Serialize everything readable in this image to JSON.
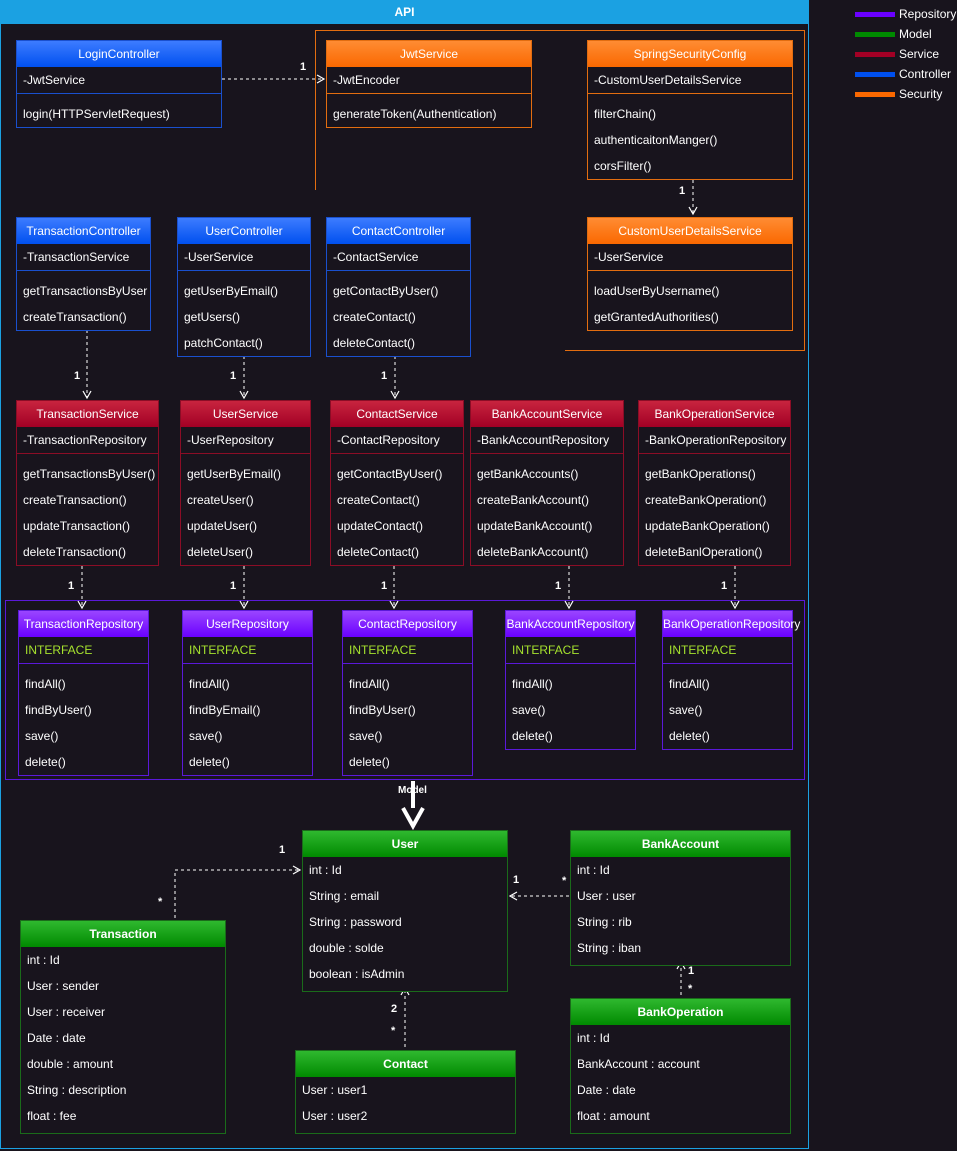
{
  "title": "API",
  "model_label": "Model",
  "legend": [
    {
      "label": "Repository",
      "color": "#6a00ff"
    },
    {
      "label": "Model",
      "color": "#008a00"
    },
    {
      "label": "Service",
      "color": "#a20025"
    },
    {
      "label": "Controller",
      "color": "#0050ef"
    },
    {
      "label": "Security",
      "color": "#fa6800"
    }
  ],
  "classes": {
    "login_controller": {
      "name": "LoginController",
      "fields": [
        "-JwtService"
      ],
      "methods": [
        "login(HTTPServletRequest)"
      ]
    },
    "jwt_service": {
      "name": "JwtService",
      "fields": [
        "-JwtEncoder"
      ],
      "methods": [
        "generateToken(Authentication)"
      ]
    },
    "spring_security_config": {
      "name": "SpringSecurityConfig",
      "fields": [
        "-CustomUserDetailsService"
      ],
      "methods": [
        "filterChain()",
        "authenticaitonManger()",
        "corsFilter()"
      ]
    },
    "custom_user_details_service": {
      "name": "CustomUserDetailsService",
      "fields": [
        "-UserService"
      ],
      "methods": [
        "loadUserByUsername()",
        "getGrantedAuthorities()"
      ]
    },
    "transaction_controller": {
      "name": "TransactionController",
      "fields": [
        "-TransactionService"
      ],
      "methods": [
        "getTransactionsByUser",
        "createTransaction()"
      ]
    },
    "user_controller": {
      "name": "UserController",
      "fields": [
        "-UserService"
      ],
      "methods": [
        "getUserByEmail()",
        "getUsers()",
        "patchContact()"
      ]
    },
    "contact_controller": {
      "name": "ContactController",
      "fields": [
        "-ContactService"
      ],
      "methods": [
        "getContactByUser()",
        "createContact()",
        "deleteContact()"
      ]
    },
    "transaction_service": {
      "name": "TransactionService",
      "fields": [
        "-TransactionRepository"
      ],
      "methods": [
        "getTransactionsByUser()",
        "createTransaction()",
        "updateTransaction()",
        "deleteTransaction()"
      ]
    },
    "user_service": {
      "name": "UserService",
      "fields": [
        "-UserRepository"
      ],
      "methods": [
        "getUserByEmail()",
        "createUser()",
        "updateUser()",
        "deleteUser()"
      ]
    },
    "contact_service": {
      "name": "ContactService",
      "fields": [
        "-ContactRepository"
      ],
      "methods": [
        "getContactByUser()",
        "createContact()",
        "updateContact()",
        "deleteContact()"
      ]
    },
    "bank_account_service": {
      "name": "BankAccountService",
      "fields": [
        "-BankAccountRepository"
      ],
      "methods": [
        "getBankAccounts()",
        "createBankAccount()",
        "updateBankAccount()",
        "deleteBankAccount()"
      ]
    },
    "bank_operation_service": {
      "name": "BankOperationService",
      "fields": [
        "-BankOperationRepository"
      ],
      "methods": [
        "getBankOperations()",
        "createBankOperation()",
        "updateBankOperation()",
        "deleteBanlOperation()"
      ]
    },
    "transaction_repository": {
      "name": "TransactionRepository",
      "fields": [
        "INTERFACE"
      ],
      "methods": [
        "findAll()",
        "findByUser()",
        "save()",
        "delete()"
      ]
    },
    "user_repository": {
      "name": "UserRepository",
      "fields": [
        "INTERFACE"
      ],
      "methods": [
        "findAll()",
        "findByEmail()",
        "save()",
        "delete()"
      ]
    },
    "contact_repository": {
      "name": "ContactRepository",
      "fields": [
        "INTERFACE"
      ],
      "methods": [
        "findAll()",
        "findByUser()",
        "save()",
        "delete()"
      ]
    },
    "bank_account_repository": {
      "name": "BankAccountRepository",
      "fields": [
        "INTERFACE"
      ],
      "methods": [
        "findAll()",
        "save()",
        "delete()"
      ]
    },
    "bank_operation_repository": {
      "name": "BankOperationRepository",
      "fields": [
        "INTERFACE"
      ],
      "methods": [
        "findAll()",
        "save()",
        "delete()"
      ]
    },
    "user": {
      "name": "User",
      "fields": [
        "int : Id",
        "String : email",
        "String : password",
        "double : solde",
        "boolean : isAdmin"
      ],
      "methods": []
    },
    "bank_account": {
      "name": "BankAccount",
      "fields": [
        "int : Id",
        "User : user",
        "String : rib",
        "String : iban"
      ],
      "methods": []
    },
    "transaction": {
      "name": "Transaction",
      "fields": [
        "int : Id",
        "User : sender",
        "User : receiver",
        "Date : date",
        "double : amount",
        "String : description",
        "float : fee"
      ],
      "methods": []
    },
    "contact": {
      "name": "Contact",
      "fields": [
        "User : user1",
        "User : user2"
      ],
      "methods": []
    },
    "bank_operation": {
      "name": "BankOperation",
      "fields": [
        "int : Id",
        "BankAccount : account",
        "Date : date",
        "float : amount"
      ],
      "methods": []
    }
  },
  "multiplicities": {
    "login_jwt": "1",
    "security_custom": "1",
    "txctrl_txsvc": "1",
    "userctrl_usersvc": "1",
    "contactctrl_contactsvc": "1",
    "txsvc_txrepo": "1",
    "usersvc_userrepo": "1",
    "contactsvc_contactrepo": "1",
    "banksvc_bankrepo": "1",
    "opsvc_oprepo": "1",
    "tx_user_one": "1",
    "tx_user_many": "*",
    "bank_user_one": "1",
    "bank_user_many": "*",
    "contact_user_one": "2",
    "contact_user_many": "*",
    "op_bank_one": "1",
    "op_bank_many": "*"
  }
}
